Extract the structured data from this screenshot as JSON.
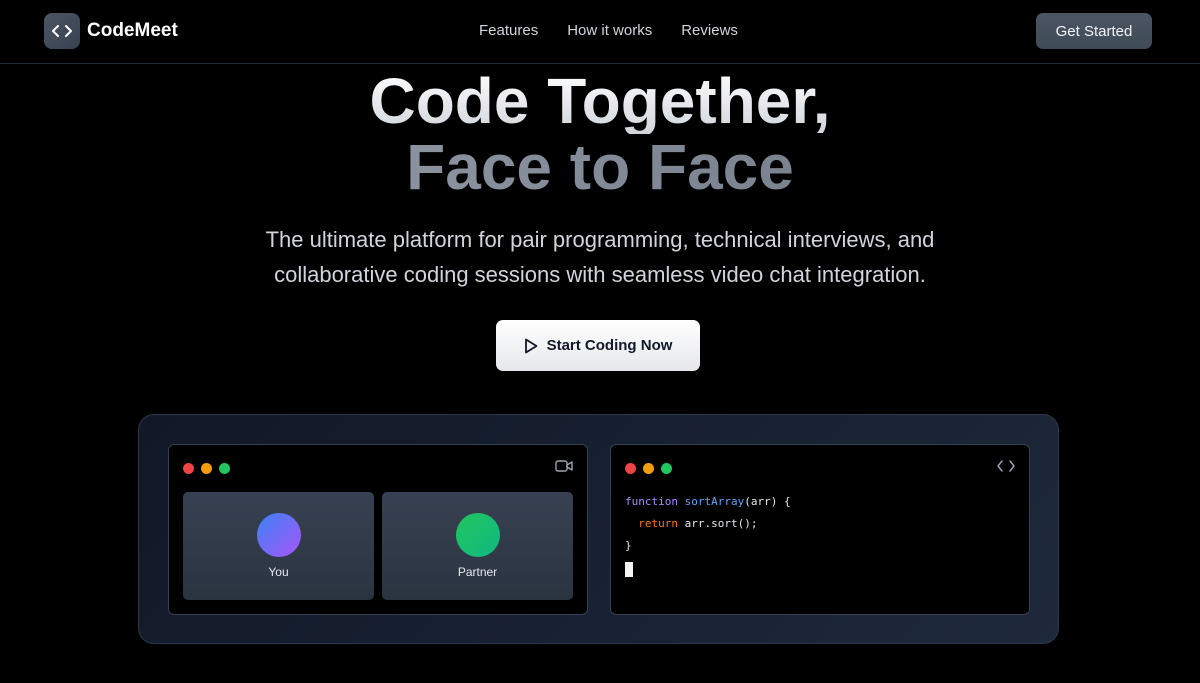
{
  "header": {
    "brand": "CodeMeet",
    "nav": [
      "Features",
      "How it works",
      "Reviews"
    ],
    "cta_label": "Get Started"
  },
  "hero": {
    "title_line1": "Code Together,",
    "title_line2": "Face to Face",
    "subtitle": "The ultimate platform for pair programming, technical interviews, and collaborative coding sessions with seamless video chat integration.",
    "cta_label": "Start Coding Now",
    "cta_icon": "play-icon"
  },
  "demo": {
    "video_window": {
      "icon": "video-camera-icon",
      "participants": [
        {
          "label": "You"
        },
        {
          "label": "Partner"
        }
      ]
    },
    "code_window": {
      "icon": "code-icon",
      "code": {
        "line1_kw": "function",
        "line1_fn": "sortArray",
        "line1_rest": "(arr) {",
        "line2_indent": "  ",
        "line2_kw": "return",
        "line2_rest": " arr.sort();",
        "line3": "}"
      }
    }
  },
  "colors": {
    "background": "#000000",
    "accent_button": "#4b5563",
    "dot_red": "#ef4444",
    "dot_yellow": "#f59e0b",
    "dot_green": "#22c55e"
  }
}
